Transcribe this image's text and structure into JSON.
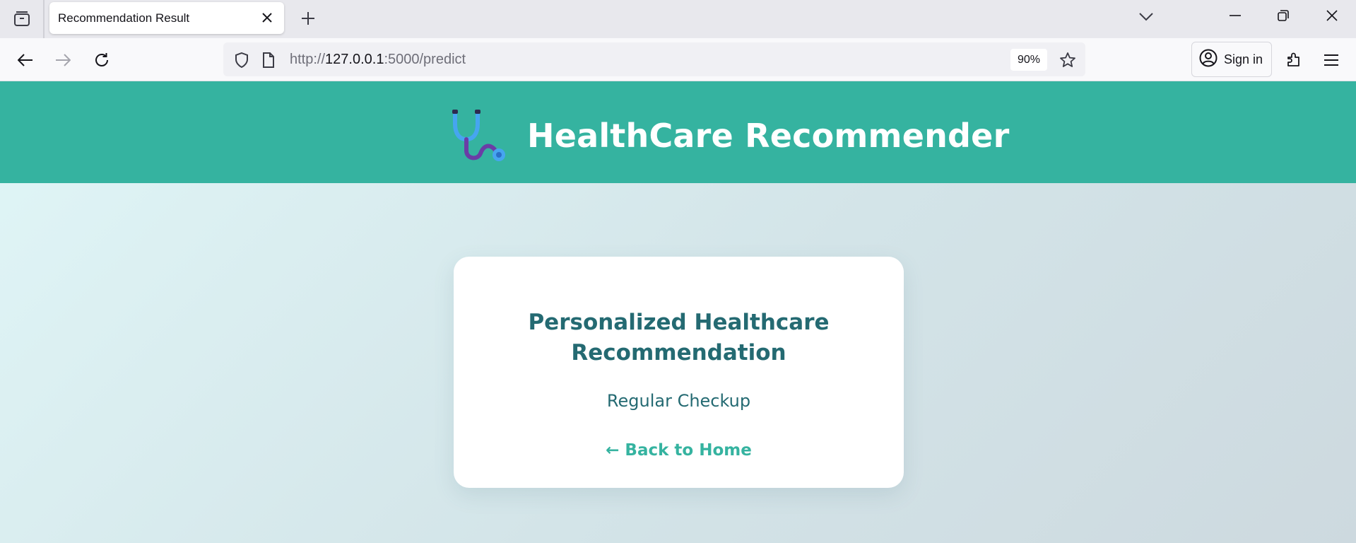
{
  "browser": {
    "tab": {
      "title": "Recommendation Result"
    },
    "url": {
      "scheme": "http://",
      "host": "127.0.0.1",
      "rest": ":5000/predict"
    },
    "zoom": "90%",
    "signin_label": "Sign in"
  },
  "site": {
    "title": "HealthCare Recommender",
    "logo_icon": "stethoscope-icon"
  },
  "card": {
    "title_line1": "Personalized Healthcare",
    "title_line2": "Recommendation",
    "result": "Regular Checkup",
    "back_link": "← Back to Home"
  },
  "colors": {
    "header": "#35b3a0",
    "heading_text": "#246a72",
    "link": "#35b3a0"
  }
}
